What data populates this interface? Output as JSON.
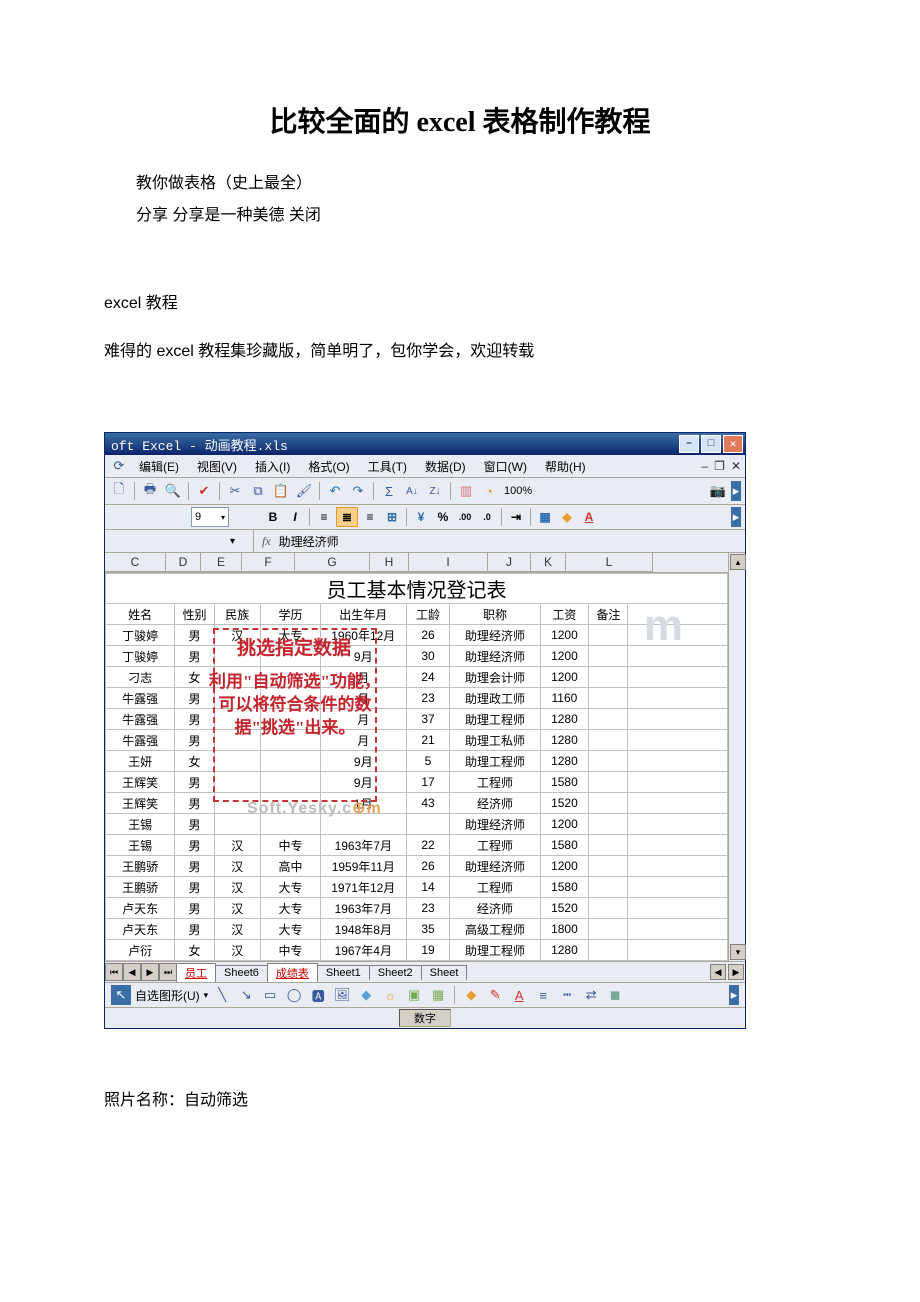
{
  "doc": {
    "title": "比较全面的 excel 表格制作教程",
    "line1": "教你做表格（史上最全）",
    "line2": "分享 分享是一种美德 关闭",
    "line3": "excel 教程",
    "line4": "难得的 excel 教程集珍藏版，简单明了，包你学会，欢迎转载",
    "caption": "照片名称：自动筛选"
  },
  "window": {
    "title": "oft Excel - 动画教程.xls",
    "menus": [
      "编辑(E)",
      "视图(V)",
      "插入(I)",
      "格式(O)",
      "工具(T)",
      "数据(D)",
      "窗口(W)",
      "帮助(H)"
    ],
    "zoom": "100%",
    "fontsize": "9",
    "formula_value": "助理经济师",
    "columns": [
      "C",
      "D",
      "E",
      "F",
      "G",
      "H",
      "I",
      "J",
      "K",
      "L"
    ],
    "sheet_title": "员工基本情况登记表",
    "headers": [
      "姓名",
      "性别",
      "民族",
      "学历",
      "出生年月",
      "工龄",
      "职称",
      "工资",
      "备注"
    ],
    "rows": [
      [
        "丁骏婷",
        "男",
        "汉",
        "大专",
        "1960年12月",
        "26",
        "助理经济师",
        "1200",
        ""
      ],
      [
        "丁骏婷",
        "男",
        "",
        "",
        "9月",
        "30",
        "助理经济师",
        "1200",
        ""
      ],
      [
        "刁志",
        "女",
        "",
        "",
        "月",
        "24",
        "助理会计师",
        "1200",
        ""
      ],
      [
        "牛露强",
        "男",
        "",
        "",
        "月",
        "23",
        "助理政工师",
        "1160",
        ""
      ],
      [
        "牛露强",
        "男",
        "",
        "",
        "月",
        "37",
        "助理工程师",
        "1280",
        ""
      ],
      [
        "牛露强",
        "男",
        "",
        "",
        "月",
        "21",
        "助理工私师",
        "1280",
        ""
      ],
      [
        "王妍",
        "女",
        "",
        "",
        "9月",
        "5",
        "助理工程师",
        "1280",
        ""
      ],
      [
        "王辉笑",
        "男",
        "",
        "",
        "9月",
        "17",
        "工程师",
        "1580",
        ""
      ],
      [
        "王辉笑",
        "男",
        "",
        "",
        "1月",
        "43",
        "经济师",
        "1520",
        ""
      ],
      [
        "王锡",
        "男",
        "",
        "",
        "",
        "",
        "助理经济师",
        "1200",
        ""
      ],
      [
        "王锡",
        "男",
        "汉",
        "中专",
        "1963年7月",
        "22",
        "工程师",
        "1580",
        ""
      ],
      [
        "王鹏骄",
        "男",
        "汉",
        "高中",
        "1959年11月",
        "26",
        "助理经济师",
        "1200",
        ""
      ],
      [
        "王鹏骄",
        "男",
        "汉",
        "大专",
        "1971年12月",
        "14",
        "工程师",
        "1580",
        ""
      ],
      [
        "卢天东",
        "男",
        "汉",
        "大专",
        "1963年7月",
        "23",
        "经济师",
        "1520",
        ""
      ],
      [
        "卢天东",
        "男",
        "汉",
        "大专",
        "1948年8月",
        "35",
        "高级工程师",
        "1800",
        ""
      ],
      [
        "卢衍",
        "女",
        "汉",
        "中专",
        "1967年4月",
        "19",
        "助理工程师",
        "1280",
        ""
      ]
    ],
    "tabs": [
      "员工",
      "Sheet6",
      "成绩表",
      "Sheet1",
      "Sheet2",
      "Sheet"
    ],
    "drawing_label": "自选图形(U)",
    "status": "数字",
    "callout_pick": "挑选指定数据",
    "callout_desc": "利用\"自动筛选\"功能，可以将符合条件的数据\"挑选\"出来。",
    "watermark": "Soft.Yesky.c"
  }
}
